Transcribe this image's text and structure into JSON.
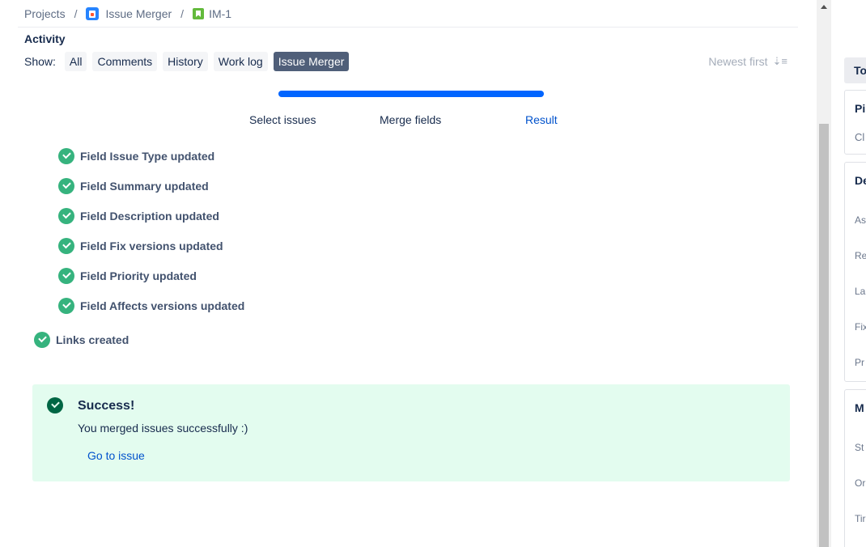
{
  "breadcrumb": {
    "projects": "Projects",
    "separator": "/",
    "project": "Issue Merger",
    "issue_key": "IM-1"
  },
  "activity": {
    "title": "Activity",
    "show_label": "Show:",
    "filters": [
      "All",
      "Comments",
      "History",
      "Work log",
      "Issue Merger"
    ],
    "active_filter": "Issue Merger",
    "sort_label": "Newest first",
    "sort_icon": "sort-descending-icon"
  },
  "wizard": {
    "steps": [
      "Select issues",
      "Merge fields",
      "Result"
    ],
    "current_step": "Result"
  },
  "results": {
    "field_updates": [
      "Field Issue Type updated",
      "Field Summary updated",
      "Field Description updated",
      "Field Fix versions updated",
      "Field Priority updated",
      "Field Affects versions updated"
    ],
    "links": "Links created"
  },
  "success": {
    "title": "Success!",
    "message": "You merged issues successfully :)",
    "link": "Go to issue"
  },
  "right_panel": {
    "button": "To",
    "cards": [
      {
        "head": "Pi",
        "rows": [
          "Cl"
        ]
      },
      {
        "head": "De",
        "rows": [
          "As",
          "Re",
          "La",
          "Fix",
          "Pr"
        ]
      },
      {
        "head": "M",
        "rows": [
          "St",
          "Or",
          "Tir"
        ]
      }
    ]
  },
  "colors": {
    "accent": "#0052cc",
    "progress": "#0065ff",
    "success_icon": "#36b37e",
    "success_bg": "#e3fcef",
    "active_filter_bg": "#505f79"
  }
}
